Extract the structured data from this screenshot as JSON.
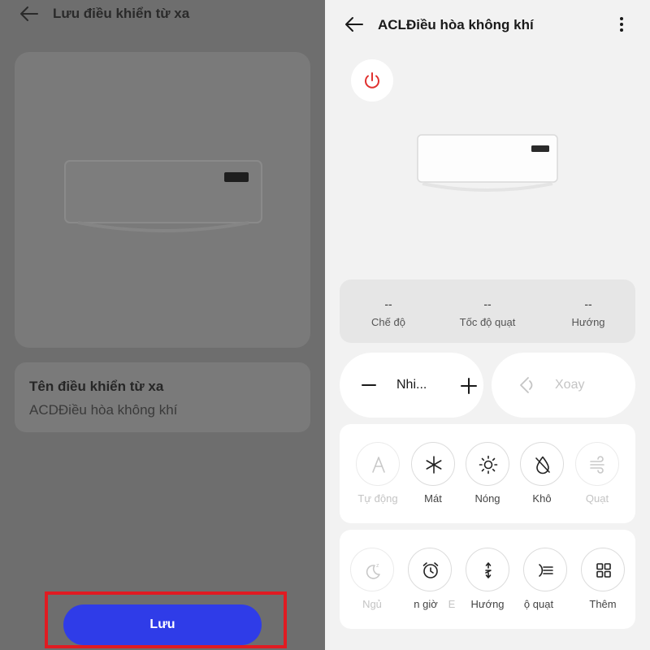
{
  "save_screen": {
    "title": "Lưu điều khiển từ xa",
    "name_label": "Tên điều khiển từ xa",
    "name_value": "ACDĐiều hòa không khí",
    "save_label": "Lưu"
  },
  "control_screen": {
    "title": "ACLĐiều hòa không khí",
    "status": [
      {
        "value": "--",
        "label": "Chế độ"
      },
      {
        "value": "--",
        "label": "Tốc độ quạt"
      },
      {
        "value": "--",
        "label": "Hướng"
      }
    ],
    "temperature_label": "Nhi...",
    "swing_label": "Xoay",
    "modes": [
      {
        "label": "Tự động",
        "icon": "auto-icon",
        "enabled": false
      },
      {
        "label": "Mát",
        "icon": "snowflake-icon",
        "enabled": true
      },
      {
        "label": "Nóng",
        "icon": "sun-icon",
        "enabled": true
      },
      {
        "label": "Khô",
        "icon": "droplet-icon",
        "enabled": true
      },
      {
        "label": "Quạt",
        "icon": "wind-icon",
        "enabled": false
      }
    ],
    "functions": [
      {
        "label": "Ngủ",
        "icon": "sleep-icon",
        "enabled": false
      },
      {
        "label": "n giờ",
        "icon": "alarm-clock-icon",
        "enabled": true
      },
      {
        "label": "E",
        "enabled": false
      },
      {
        "label": "Hướng",
        "icon": "direction-icon",
        "enabled": true
      },
      {
        "label": "ộ quạt",
        "icon": "fan-speed-icon",
        "enabled": true
      },
      {
        "label": "Thêm",
        "icon": "grid-icon",
        "enabled": true
      }
    ]
  },
  "colors": {
    "accent_blue": "#2f3ce8",
    "highlight_red": "#e01b22",
    "power_red": "#e0312f",
    "overlay_gray": "#6e6e6e"
  }
}
